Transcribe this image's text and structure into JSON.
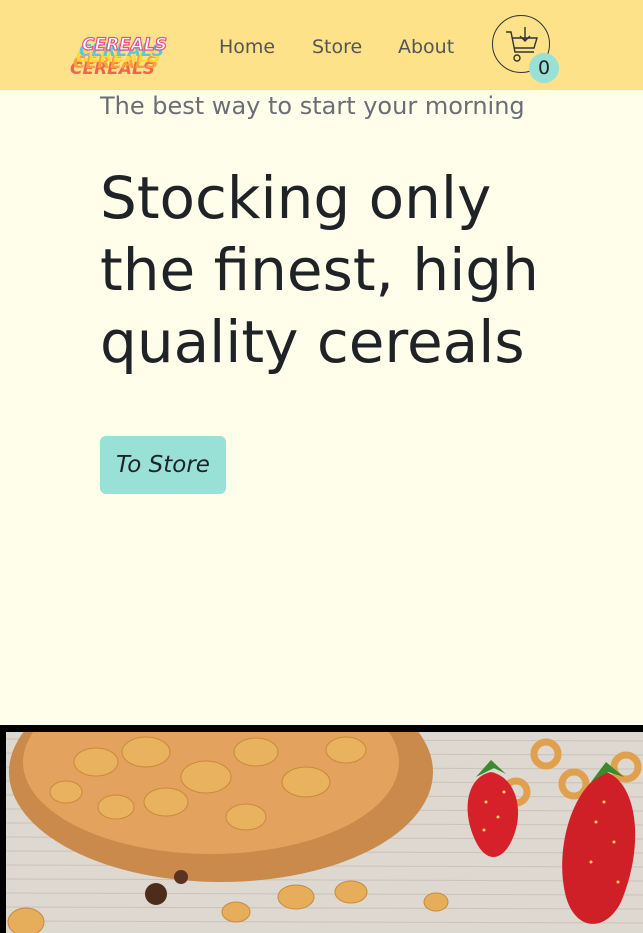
{
  "header": {
    "logo_text": "CEREALS",
    "nav": [
      {
        "label": "Home"
      },
      {
        "label": "Store"
      },
      {
        "label": "About"
      }
    ],
    "cart": {
      "count": "0"
    }
  },
  "hero": {
    "tagline": "The best way to start your morning",
    "title": "Stocking only the finest, high quality cereals",
    "button_label": "To Store"
  },
  "colors": {
    "header_bg": "#fde28a",
    "page_bg": "#fffeea",
    "accent": "#99e0d7",
    "text": "#1f2227",
    "muted": "#6b6e76"
  },
  "icons": {
    "cart": "shopping-basket-icon"
  }
}
